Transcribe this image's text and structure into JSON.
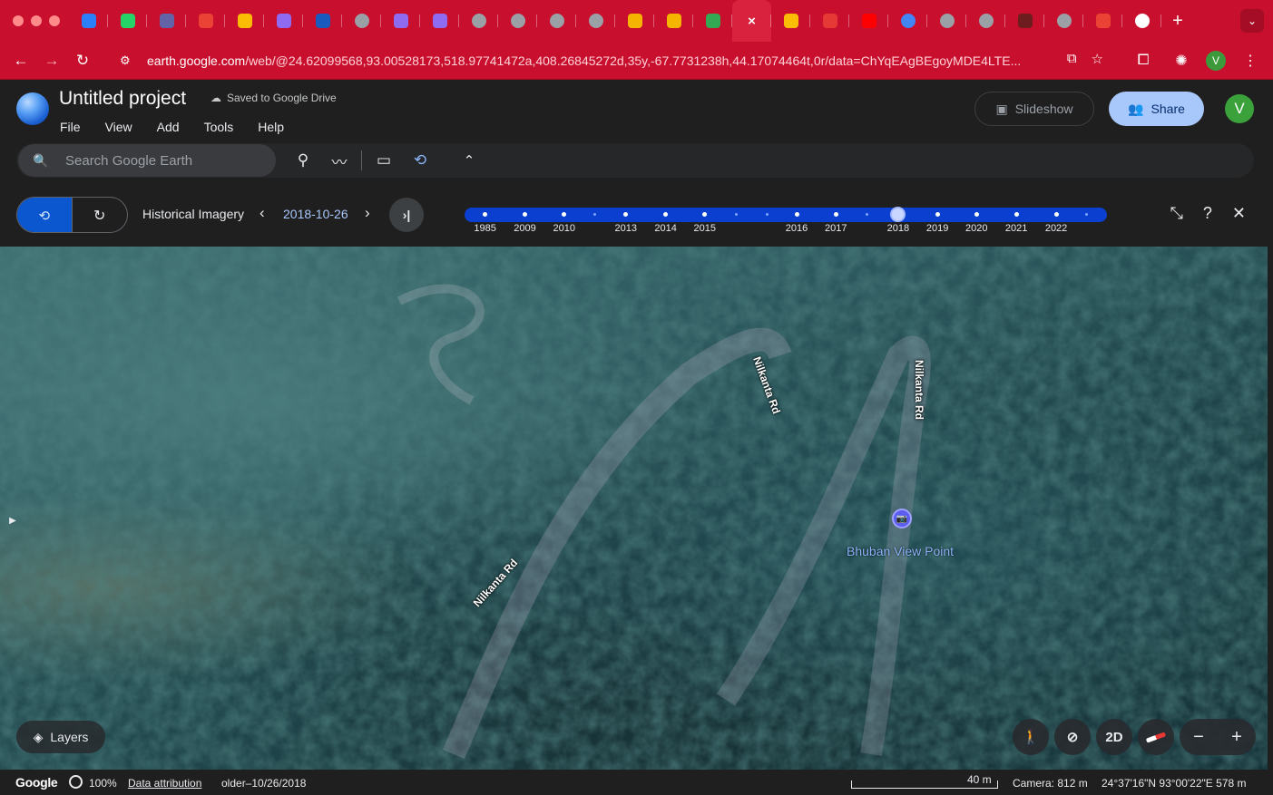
{
  "browser": {
    "url_host": "earth.google.com",
    "url_rest": "/web/@24.62099568,93.00528173,518.97741472a,408.26845272d,35y,-67.7731238h,44.17074464t,0r/data=ChYqEAgBEgoyMDE4LTE...",
    "tab_icons": [
      "onedrive-icon",
      "whatsapp-icon",
      "teams-icon",
      "gmail-icon",
      "drive-icon",
      "copilot-icon",
      "word-icon",
      "chrome-icon",
      "copilot-icon",
      "copilot-icon",
      "chrome-icon",
      "chrome-icon",
      "chrome-icon",
      "chrome-icon",
      "figure-icon",
      "figure-icon",
      "maps-icon",
      "close-tab",
      "earth-icon",
      "toi-icon",
      "youtube-icon",
      "google-icon",
      "chrome-icon",
      "chrome-icon",
      "figure-icon",
      "chrome-icon",
      "gmail-icon",
      "google-icon"
    ],
    "tab_colors": [
      "#2d7ff9",
      "#25d366",
      "#6264a7",
      "#ea4335",
      "#fbbc04",
      "#8e6bf0",
      "#185abd",
      "#9aa0a6",
      "#8e6bf0",
      "#8e6bf0",
      "#9aa0a6",
      "#9aa0a6",
      "#9aa0a6",
      "#9aa0a6",
      "#f4b400",
      "#f4b400",
      "#34a853",
      "#ffffff",
      "#fbbc04",
      "#e53935",
      "#ff0000",
      "#4285f4",
      "#9aa0a6",
      "#9aa0a6",
      "#6d1d1d",
      "#9aa0a6",
      "#ea4335",
      "#ffffff"
    ],
    "active_tab_symbol": "×",
    "new_tab": "+",
    "tab_menu": "⌄",
    "profile_initial": "V"
  },
  "app": {
    "title": "Untitled project",
    "saved_status": "Saved to Google Drive",
    "menu": [
      "File",
      "View",
      "Add",
      "Tools",
      "Help"
    ],
    "slideshow_label": "Slideshow",
    "share_label": "Share",
    "avatar_initial": "V",
    "search_placeholder": "Search Google Earth"
  },
  "history": {
    "label": "Historical Imagery",
    "current_date": "2018-10-26",
    "selected_year": "2018",
    "years": [
      {
        "label": "1985",
        "frac": 0.032
      },
      {
        "label": "2009",
        "frac": 0.094
      },
      {
        "label": "2010",
        "frac": 0.155
      },
      {
        "label": "2013",
        "frac": 0.251
      },
      {
        "label": "2014",
        "frac": 0.313
      },
      {
        "label": "2015",
        "frac": 0.374
      },
      {
        "label": "2016",
        "frac": 0.517
      },
      {
        "label": "2017",
        "frac": 0.578
      },
      {
        "label": "2018",
        "frac": 0.675
      },
      {
        "label": "2019",
        "frac": 0.736
      },
      {
        "label": "2020",
        "frac": 0.797
      },
      {
        "label": "2021",
        "frac": 0.859
      },
      {
        "label": "2022",
        "frac": 0.921
      }
    ],
    "minor_marks": [
      0.203,
      0.423,
      0.471,
      0.627,
      0.968
    ],
    "selected_frac": 0.675
  },
  "map": {
    "road_label": "Nilkanta Rd",
    "place_label": "Bhuban View Point",
    "layers_label": "Layers",
    "view_mode": "2D"
  },
  "status": {
    "brand": "Google",
    "load_pct": "100%",
    "attribution": "Data attribution",
    "imagery_date": "older–10/26/2018",
    "scale": "40 m",
    "camera": "Camera: 812 m",
    "coords": "24°37'16\"N 93°00'22\"E  578 m"
  }
}
